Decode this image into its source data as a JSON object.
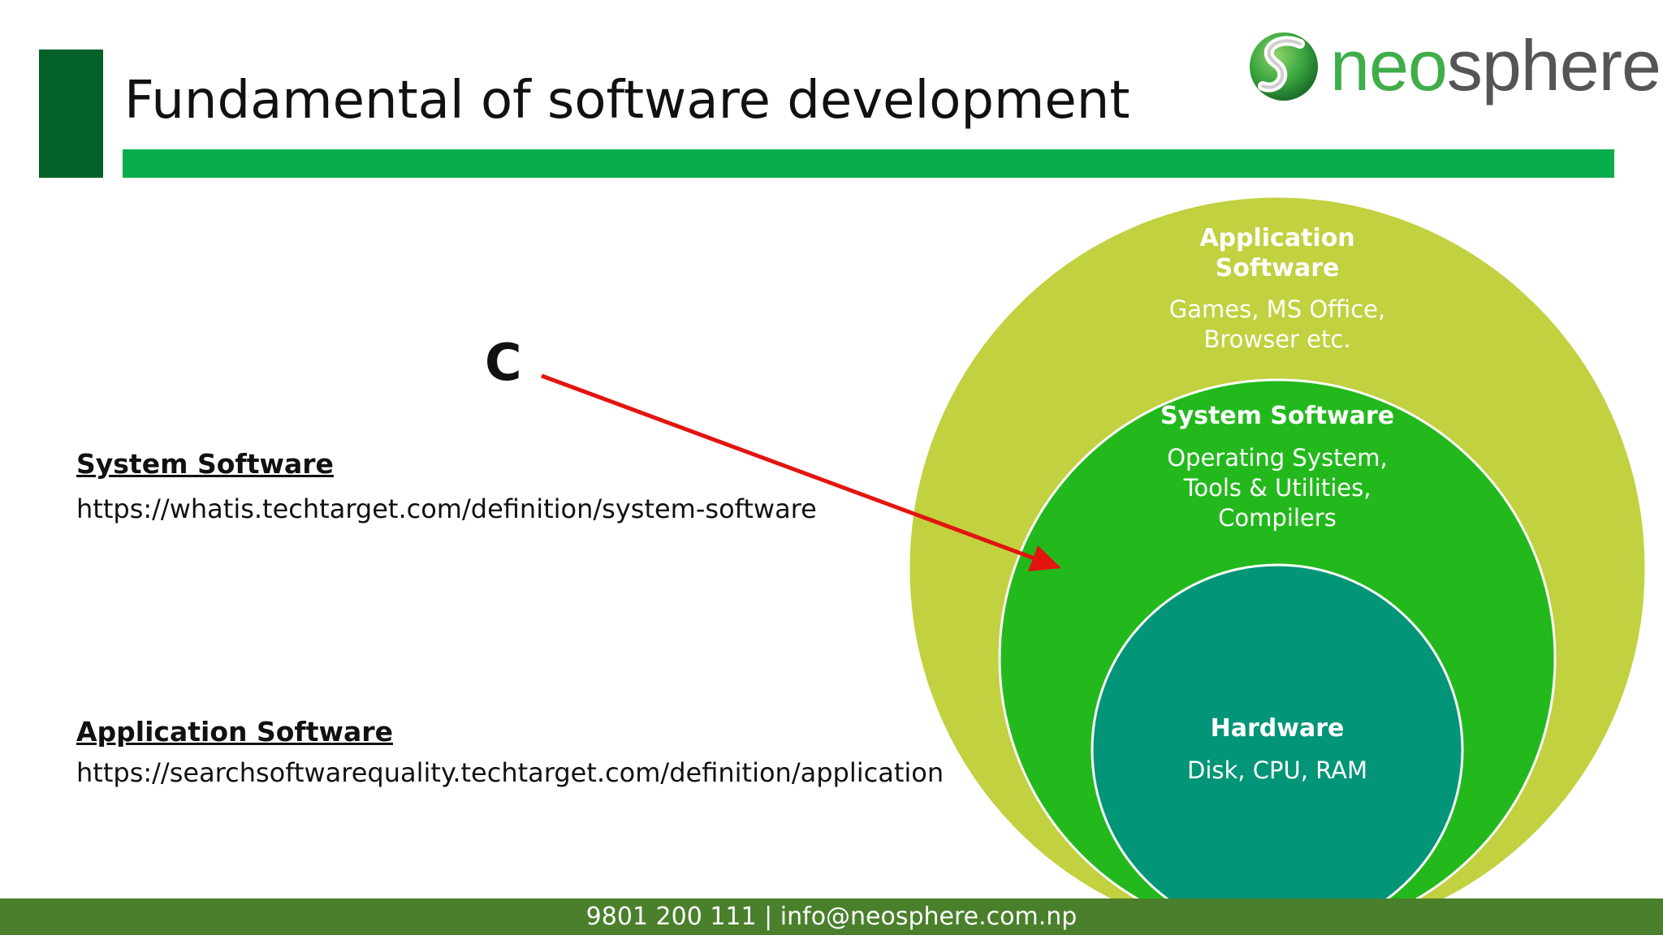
{
  "slide": {
    "title": "Fundamental of software development"
  },
  "logo": {
    "part1": "neo",
    "part2": "sphere",
    "icon": "neosphere-s-logo-icon"
  },
  "links": [
    {
      "heading": "System Software",
      "url": "https://whatis.techtarget.com/definition/system-software"
    },
    {
      "heading": "Application Software",
      "url": "https://searchsoftwarequality.techtarget.com/definition/application"
    }
  ],
  "annotation": {
    "label": "C",
    "color": "#e3140f"
  },
  "diagram": {
    "layers": [
      {
        "title_line1": "Application",
        "title_line2": "Software",
        "desc_line1": "Games, MS Office,",
        "desc_line2": "Browser etc.",
        "color": "#c1d13f"
      },
      {
        "title": "System Software",
        "desc_line1": "Operating System,",
        "desc_line2": "Tools & Utilities,",
        "desc_line3": "Compilers",
        "color": "#23b91d"
      },
      {
        "title": "Hardware",
        "desc": "Disk, CPU, RAM",
        "color": "#029577"
      }
    ]
  },
  "footer": {
    "contact": "9801 200 111 | info@neosphere.com.np"
  },
  "colors": {
    "accent_dark_green": "#046229",
    "rule_green": "#0aad4b",
    "footer_green": "#4a7f2c"
  }
}
